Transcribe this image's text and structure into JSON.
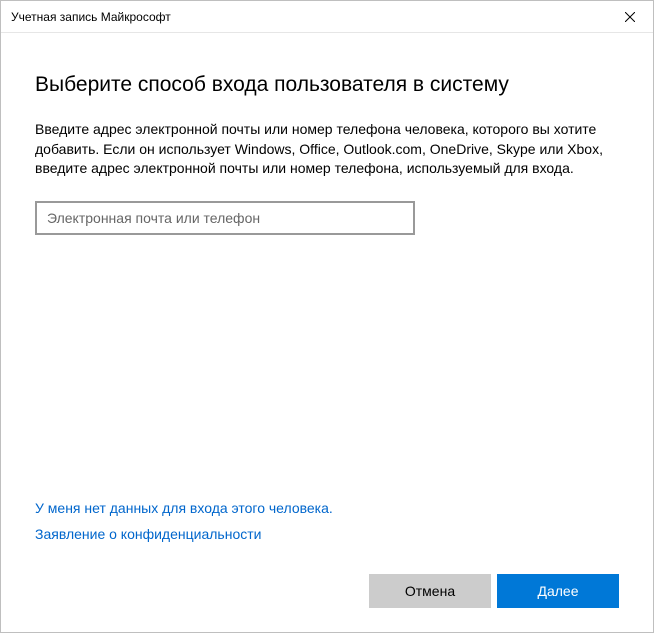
{
  "titlebar": {
    "title": "Учетная запись Майкрософт"
  },
  "main": {
    "heading": "Выберите способ входа пользователя в систему",
    "description": "Введите адрес электронной почты или номер телефона человека, которого вы хотите добавить. Если он использует Windows, Office, Outlook.com, OneDrive, Skype или Xbox, введите адрес электронной почты или номер телефона, используемый для входа.",
    "input": {
      "placeholder": "Электронная почта или телефон",
      "value": ""
    }
  },
  "links": {
    "no_signin_info": "У меня нет данных для входа этого человека.",
    "privacy_statement": "Заявление о конфиденциальности"
  },
  "buttons": {
    "cancel": "Отмена",
    "next": "Далее"
  }
}
